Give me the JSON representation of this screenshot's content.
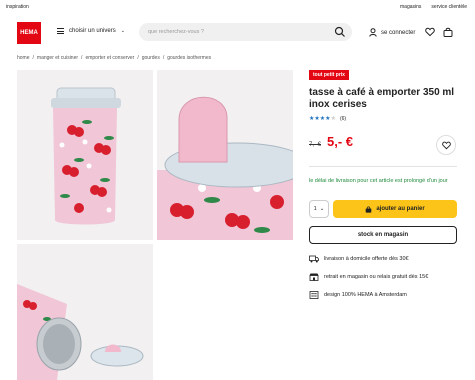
{
  "topbar": {
    "inspiration": "inspiration",
    "stores": "magasins",
    "service": "service clientèle"
  },
  "header": {
    "logo": "HEMA",
    "menu_label": "choisir un univers",
    "search_placeholder": "que recherchez-vous ?",
    "login_label": "se connecter"
  },
  "breadcrumb": [
    "home",
    "manger et cuisiner",
    "emporter et conserver",
    "gourdes",
    "gourdes isothermes"
  ],
  "breadcrumb_separator": "/",
  "product": {
    "badge": "tout petit prix",
    "title": "tasse à café à emporter 350 ml inox cerises",
    "rating": 4,
    "rating_max": 5,
    "review_count": "(6)",
    "old_price": "7,- €",
    "new_price": "5,- €",
    "delivery_note": "le délai de livraison pour cet article est prolongé d'un jour",
    "quantity": "1",
    "add_to_cart_label": "ajouter au panier",
    "stock_label": "stock en magasin",
    "features": [
      {
        "icon": "truck-icon",
        "text": "livraison à domicile offerte dès 30€"
      },
      {
        "icon": "store-icon",
        "text": "retrait en magasin ou relais gratuit dès 15€"
      },
      {
        "icon": "design-icon",
        "text": "design 100% HEMA à Amsterdam"
      }
    ]
  },
  "colors": {
    "brand": "#e30613",
    "cta": "#fcc419",
    "note": "#1f8a3b",
    "star": "#1e73be"
  }
}
